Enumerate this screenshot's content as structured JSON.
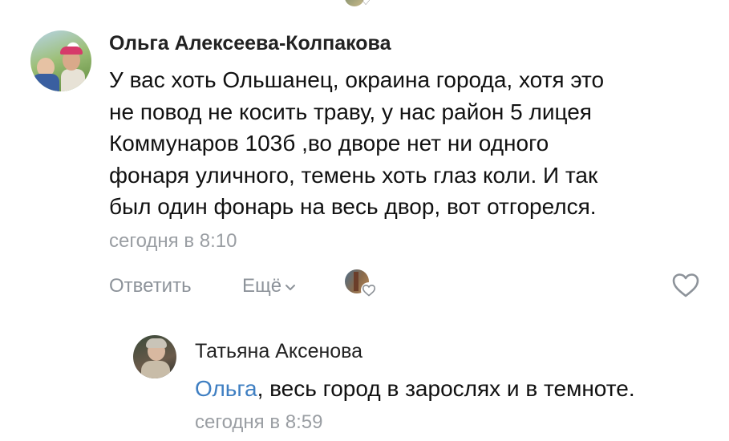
{
  "colors": {
    "background": "#ffffff",
    "text": "#111111",
    "secondary_text": "#9a9ea3",
    "action_text": "#8d939a",
    "link": "#3f7fc2"
  },
  "comments": [
    {
      "author": "Ольга Алексеева-Колпакова",
      "avatar_icon": "user-avatar-photo",
      "text_lines": [
        "У вас хоть Ольшанец, окраина города, хотя это",
        "не повод не косить траву, у нас район 5 лицея",
        "Коммунаров 103б ,во дворе нет ни одного",
        "фонаря уличного, темень хоть глаз коли. И так",
        "был один фонарь на весь двор, вот отгорелся."
      ],
      "timestamp": "сегодня в 8:10",
      "actions": {
        "reply_label": "Ответить",
        "more_label": "Ещё",
        "more_icon": "chevron-down-icon",
        "liker_icon": "liker-avatar-photo",
        "like_icon": "heart-outline-icon"
      }
    }
  ],
  "replies": [
    {
      "author": "Татьяна Аксенова",
      "avatar_icon": "user-avatar-photo",
      "mention": "Ольга",
      "text": ", весь город в зарослях и в темноте.",
      "timestamp": "сегодня в 8:59"
    }
  ]
}
